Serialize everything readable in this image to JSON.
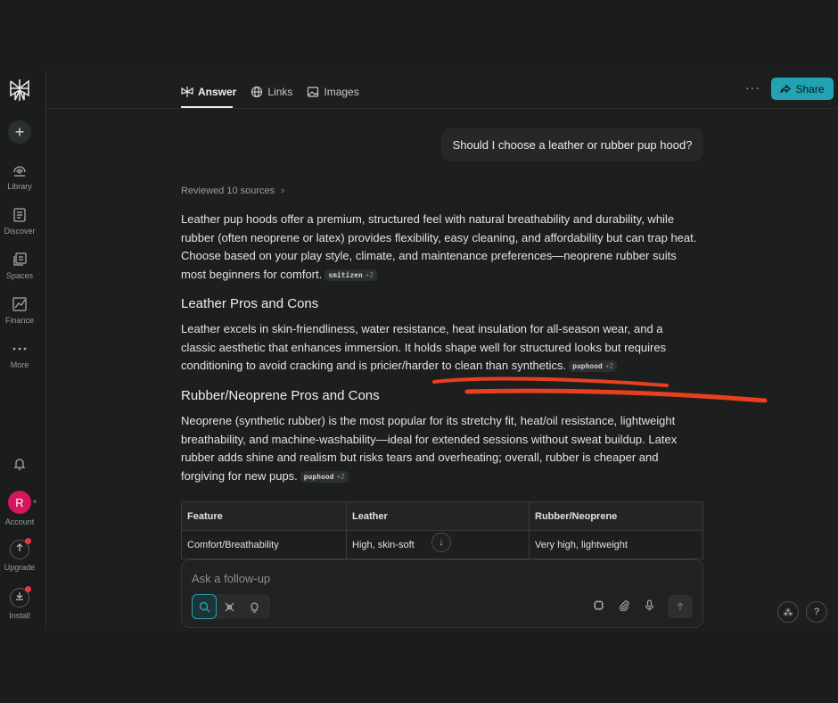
{
  "sidebar": {
    "items": [
      {
        "label": "Library",
        "icon": "library-icon"
      },
      {
        "label": "Discover",
        "icon": "discover-icon"
      },
      {
        "label": "Spaces",
        "icon": "spaces-icon"
      },
      {
        "label": "Finance",
        "icon": "finance-icon"
      },
      {
        "label": "More",
        "icon": "more-icon"
      }
    ],
    "avatar_letter": "R",
    "account_label": "Account",
    "upgrade_label": "Upgrade",
    "install_label": "Install"
  },
  "header": {
    "tabs": [
      {
        "label": "Answer",
        "active": true
      },
      {
        "label": "Links",
        "active": false
      },
      {
        "label": "Images",
        "active": false
      }
    ],
    "more": "···",
    "share_label": "Share"
  },
  "thread": {
    "question": "Should I choose a leather or rubber pup hood?",
    "sources": "Reviewed 10 sources",
    "intro": "Leather pup hoods offer a premium, structured feel with natural breathability and durability, while rubber (often neoprene or latex) provides flexibility, easy cleaning, and affordability but can trap heat. Choose based on your play style, climate, and maintenance preferences—neoprene rubber suits most beginners for comfort.",
    "intro_cite": "smitizen",
    "intro_cite_more": "+2",
    "section1_title": "Leather Pros and Cons",
    "section1_body": "Leather excels in skin-friendliness, water resistance, heat insulation for all-season wear, and a classic aesthetic that enhances immersion. It holds shape well for structured looks but requires conditioning to avoid cracking and is pricier/harder to clean than synthetics.",
    "section1_cite": "puphood",
    "section1_cite_more": "+2",
    "section2_title": "Rubber/Neoprene Pros and Cons",
    "section2_body": "Neoprene (synthetic rubber) is the most popular for its stretchy fit, heat/oil resistance, lightweight breathability, and machine-washability—ideal for extended sessions without sweat buildup. Latex rubber adds shine and realism but risks tears and overheating; overall, rubber is cheaper and forgiving for new pups.",
    "section2_cite": "puphood",
    "section2_cite_more": "+2",
    "table": {
      "headers": [
        "Feature",
        "Leather",
        "Rubber/Neoprene"
      ],
      "rows": [
        [
          "Comfort/Breathability",
          "High, skin-soft",
          "Very high, lightweight"
        ]
      ]
    }
  },
  "composer": {
    "placeholder": "Ask a follow-up"
  },
  "colors": {
    "accent": "#21a3b4",
    "scribble": "#e8401f",
    "avatar": "#d4165c"
  }
}
